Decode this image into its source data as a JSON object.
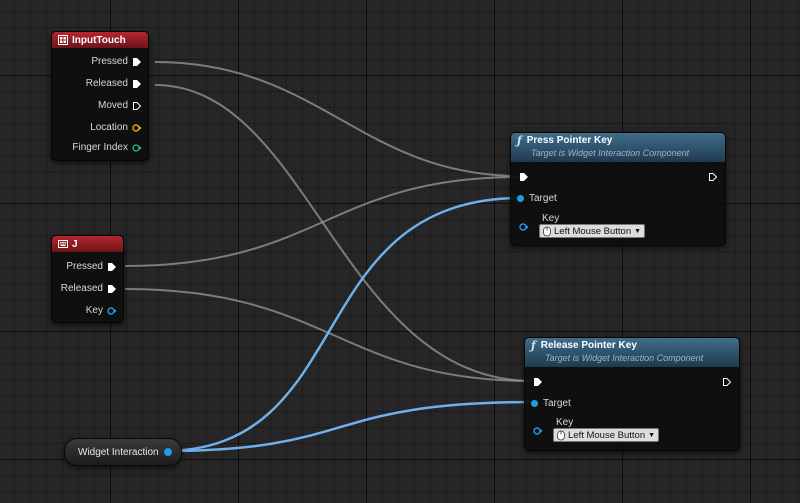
{
  "nodes": {
    "input_touch": {
      "title": "InputTouch",
      "pins": [
        "Pressed",
        "Released",
        "Moved",
        "Location",
        "Finger Index"
      ]
    },
    "key_j": {
      "title": "J",
      "pins": [
        "Pressed",
        "Released",
        "Key"
      ]
    },
    "press_pointer_key": {
      "title": "Press Pointer Key",
      "subtitle": "Target is Widget Interaction Component",
      "target_label": "Target",
      "key_label": "Key",
      "key_value": "Left Mouse Button"
    },
    "release_pointer_key": {
      "title": "Release Pointer Key",
      "subtitle": "Target is Widget Interaction Component",
      "target_label": "Target",
      "key_label": "Key",
      "key_value": "Left Mouse Button"
    },
    "widget_interaction_var": {
      "label": "Widget Interaction"
    }
  },
  "colors": {
    "event_header": "#b8252f",
    "function_header": "#3f6d8b",
    "exec_pin": "#ffffff",
    "object_pin": "#1e9ce6",
    "struct_pin": "#f0a500",
    "int_pin": "#1fc7a0",
    "wire_exec": "#bcbcbc",
    "wire_object": "#6fb0ea"
  },
  "icons": {
    "input_touch": "touch-event-icon",
    "key_j": "keyboard-event-icon",
    "function": "function-f-icon",
    "key_selector": "mouse-icon"
  }
}
